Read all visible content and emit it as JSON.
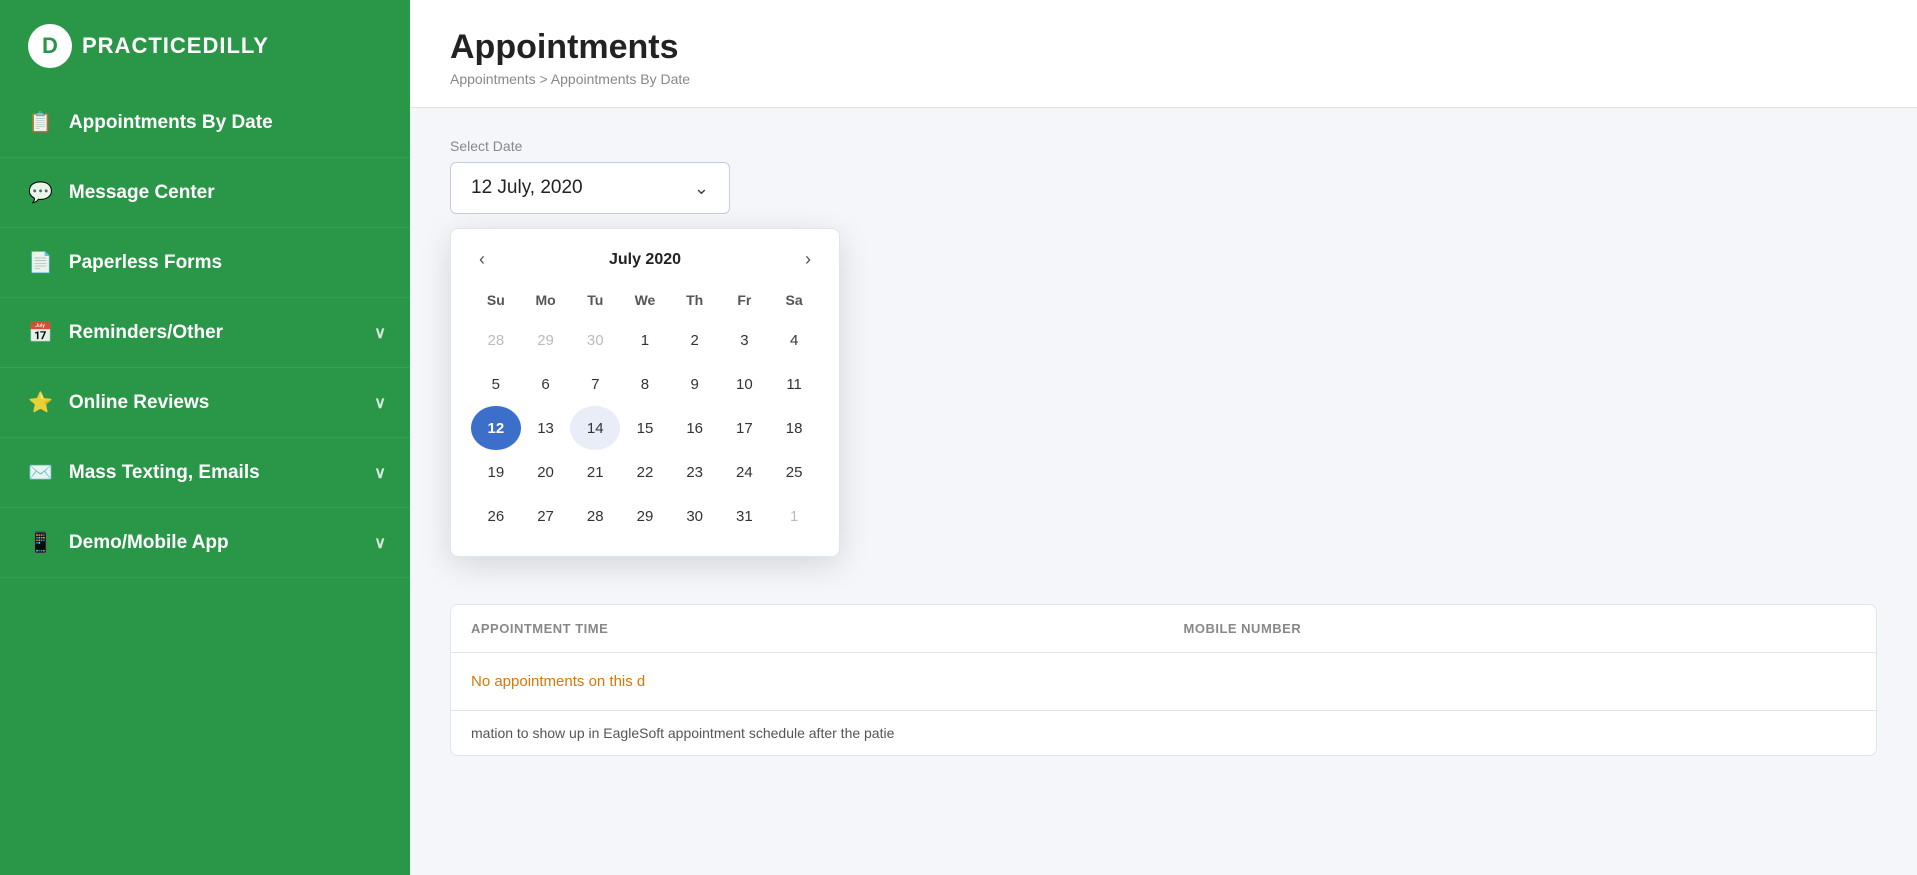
{
  "app": {
    "name": "PRACTICEDILLY",
    "logo_letter": "D"
  },
  "sidebar": {
    "items": [
      {
        "id": "appointments-by-date",
        "label": "Appointments By Date",
        "icon": "📋",
        "has_chevron": false
      },
      {
        "id": "message-center",
        "label": "Message Center",
        "icon": "💬",
        "has_chevron": false
      },
      {
        "id": "paperless-forms",
        "label": "Paperless Forms",
        "icon": "📄",
        "has_chevron": false
      },
      {
        "id": "reminders-other",
        "label": "Reminders/Other",
        "icon": "📅",
        "has_chevron": true
      },
      {
        "id": "online-reviews",
        "label": "Online Reviews",
        "icon": "⭐",
        "has_chevron": true
      },
      {
        "id": "mass-texting-emails",
        "label": "Mass Texting, Emails",
        "icon": "✉️",
        "has_chevron": true
      },
      {
        "id": "demo-mobile-app",
        "label": "Demo/Mobile App",
        "icon": "📱",
        "has_chevron": true
      }
    ]
  },
  "header": {
    "title": "Appointments",
    "breadcrumb_parts": [
      "Appointments",
      "Appointments By Date"
    ]
  },
  "date_picker": {
    "label": "Select Date",
    "selected_date": "12 July, 2020",
    "calendar": {
      "month_title": "July 2020",
      "weekdays": [
        "Su",
        "Mo",
        "Tu",
        "We",
        "Th",
        "Fr",
        "Sa"
      ],
      "weeks": [
        [
          {
            "day": 28,
            "other": true
          },
          {
            "day": 29,
            "other": true
          },
          {
            "day": 30,
            "other": true
          },
          {
            "day": 1,
            "other": false
          },
          {
            "day": 2,
            "other": false
          },
          {
            "day": 3,
            "other": false
          },
          {
            "day": 4,
            "other": false
          }
        ],
        [
          {
            "day": 5,
            "other": false
          },
          {
            "day": 6,
            "other": false
          },
          {
            "day": 7,
            "other": false
          },
          {
            "day": 8,
            "other": false
          },
          {
            "day": 9,
            "other": false
          },
          {
            "day": 10,
            "other": false
          },
          {
            "day": 11,
            "other": false
          }
        ],
        [
          {
            "day": 12,
            "other": false,
            "selected": true
          },
          {
            "day": 13,
            "other": false
          },
          {
            "day": 14,
            "other": false,
            "hovered": true
          },
          {
            "day": 15,
            "other": false
          },
          {
            "day": 16,
            "other": false
          },
          {
            "day": 17,
            "other": false
          },
          {
            "day": 18,
            "other": false
          }
        ],
        [
          {
            "day": 19,
            "other": false
          },
          {
            "day": 20,
            "other": false
          },
          {
            "day": 21,
            "other": false
          },
          {
            "day": 22,
            "other": false
          },
          {
            "day": 23,
            "other": false
          },
          {
            "day": 24,
            "other": false
          },
          {
            "day": 25,
            "other": false
          }
        ],
        [
          {
            "day": 26,
            "other": false
          },
          {
            "day": 27,
            "other": false
          },
          {
            "day": 28,
            "other": false
          },
          {
            "day": 29,
            "other": false
          },
          {
            "day": 30,
            "other": false
          },
          {
            "day": 31,
            "other": false
          },
          {
            "day": 1,
            "other": true
          }
        ]
      ]
    }
  },
  "table": {
    "columns": [
      {
        "id": "appointment-time",
        "label": "APPOINTMENT TIME"
      },
      {
        "id": "mobile-number",
        "label": "MOBILE NUMBER"
      }
    ],
    "no_appointments_text": "No appointments on this d",
    "footer_note": "mation to show up in EagleSoft appointment schedule after the patie"
  }
}
